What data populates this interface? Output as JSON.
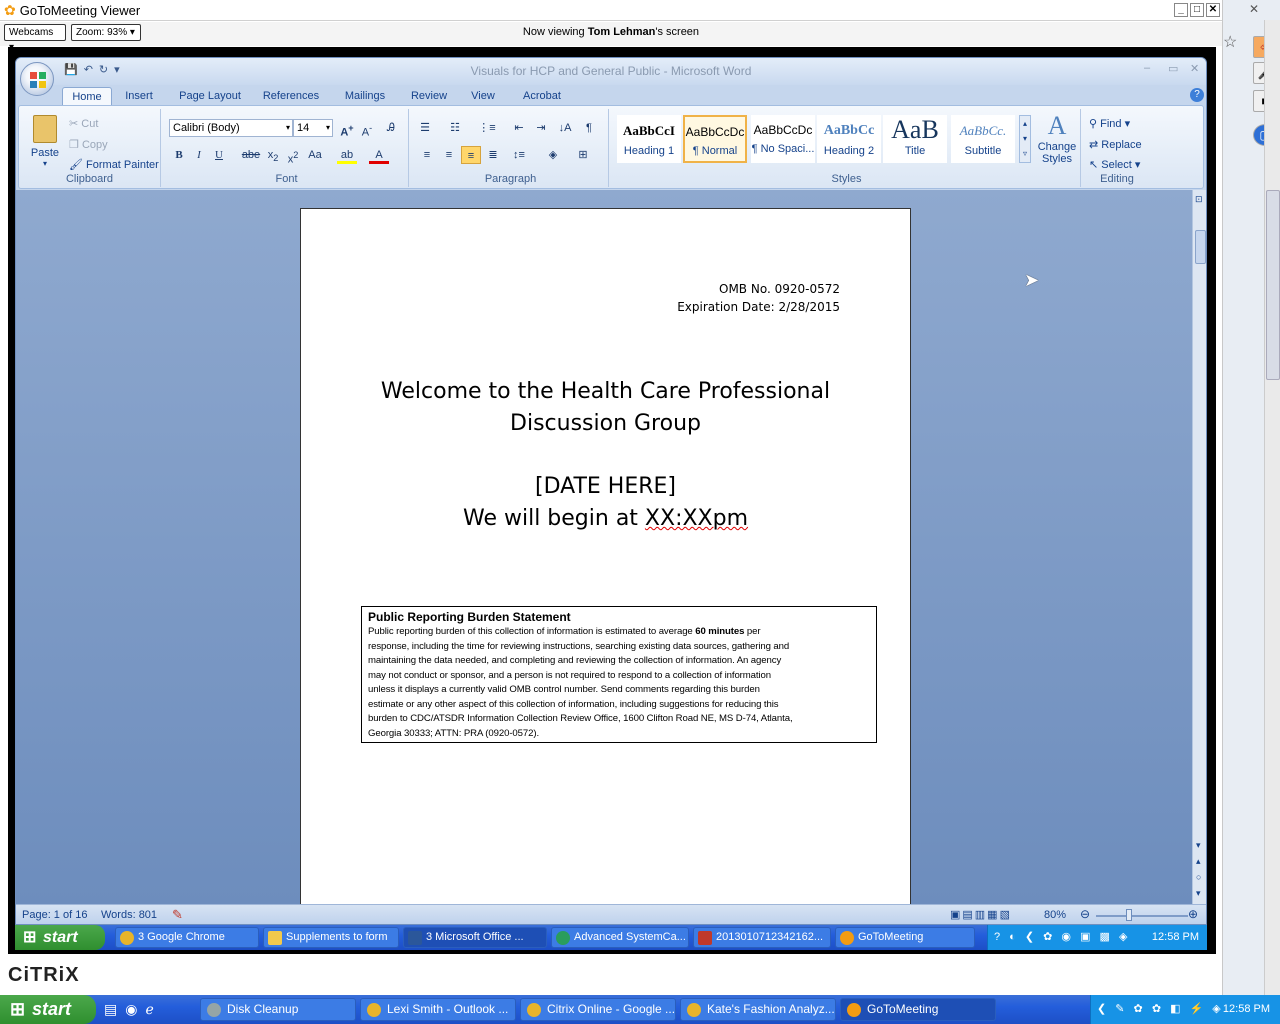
{
  "gtm": {
    "title": "GoToMeeting Viewer",
    "webcams_label": "Webcams",
    "zoom_label": "Zoom: 93%",
    "viewing_prefix": "Now viewing ",
    "viewing_name": "Tom Lehman",
    "viewing_suffix": "'s screen"
  },
  "word": {
    "title": "Visuals for HCP and General Public - Microsoft Word",
    "tabs": [
      "Home",
      "Insert",
      "Page Layout",
      "References",
      "Mailings",
      "Review",
      "View",
      "Acrobat"
    ],
    "active_tab": "Home",
    "clipboard": {
      "label": "Clipboard",
      "paste": "Paste",
      "cut": "Cut",
      "copy": "Copy",
      "format_painter": "Format Painter"
    },
    "font": {
      "label": "Font",
      "name": "Calibri (Body)",
      "size": "14"
    },
    "paragraph": {
      "label": "Paragraph"
    },
    "styles": {
      "label": "Styles",
      "items": [
        {
          "preview": "AaBbCcI",
          "name": "Heading 1"
        },
        {
          "preview": "AaBbCcDc",
          "name": "¶ Normal"
        },
        {
          "preview": "AaBbCcDc",
          "name": "¶ No Spaci..."
        },
        {
          "preview": "AaBbCc",
          "name": "Heading 2"
        },
        {
          "preview": "AaB",
          "name": "Title"
        },
        {
          "preview": "AaBbCc.",
          "name": "Subtitle"
        }
      ],
      "change_styles": "Change Styles"
    },
    "editing": {
      "label": "Editing",
      "find": "Find",
      "replace": "Replace",
      "select": "Select"
    },
    "document": {
      "omb": "OMB No. 0920-0572",
      "expiration": "Expiration Date: 2/28/2015",
      "heading_line1": "Welcome to the Health Care Professional",
      "heading_line2": "Discussion Group",
      "date_placeholder": "[DATE HERE]",
      "begin_prefix": "We will begin at ",
      "begin_time": "XX:XXpm",
      "burden_title": "Public Reporting Burden Statement",
      "burden_lines": [
        "Public reporting burden of this collection of information is estimated to average 60 minutes per",
        "response, including the time for reviewing instructions, searching existing data sources, gathering and",
        "maintaining the data  needed, and completing and reviewing the collection of information. An agency",
        "may not conduct or sponsor, and a person is not required to respond to a collection of information",
        "unless it displays a currently valid OMB control number. Send comments regarding this burden",
        "estimate or any other aspect of this collection of information, including suggestions for reducing this",
        "burden to CDC/ATSDR Information Collection Review Office, 1600 Clifton Road NE, MS D-74, Atlanta,",
        "Georgia 30333; ATTN: PRA (0920-0572)."
      ]
    },
    "status": {
      "page": "Page: 1 of 16",
      "words": "Words: 801",
      "zoom": "80%"
    }
  },
  "remote_taskbar": {
    "start": "start",
    "items": [
      {
        "label": "3 Google Chrome",
        "color": "#e8b42a"
      },
      {
        "label": "Supplements to form",
        "color": "#f2c94c"
      },
      {
        "label": "3 Microsoft Office ...",
        "color": "#2b579a"
      },
      {
        "label": "Advanced SystemCa...",
        "color": "#2a9d5c"
      },
      {
        "label": "2013010712342162...",
        "color": "#c0392b"
      },
      {
        "label": "GoToMeeting",
        "color": "#f39c12"
      }
    ],
    "time": "12:58 PM"
  },
  "citrix": "CiTRiX",
  "local_taskbar": {
    "start": "start",
    "items": [
      {
        "label": "Disk Cleanup",
        "color": "#7f8c8d"
      },
      {
        "label": "Lexi Smith - Outlook ...",
        "color": "#e8b42a"
      },
      {
        "label": "Citrix Online - Google ...",
        "color": "#e8b42a"
      },
      {
        "label": "Kate's Fashion Analyz...",
        "color": "#e8b42a"
      },
      {
        "label": "GoToMeeting",
        "color": "#f39c12"
      }
    ],
    "time": "12:58 PM"
  },
  "colors": {
    "ribbon_text": "#15428b",
    "xp_blue": "#245edb",
    "start_green": "#3a9d3a"
  }
}
